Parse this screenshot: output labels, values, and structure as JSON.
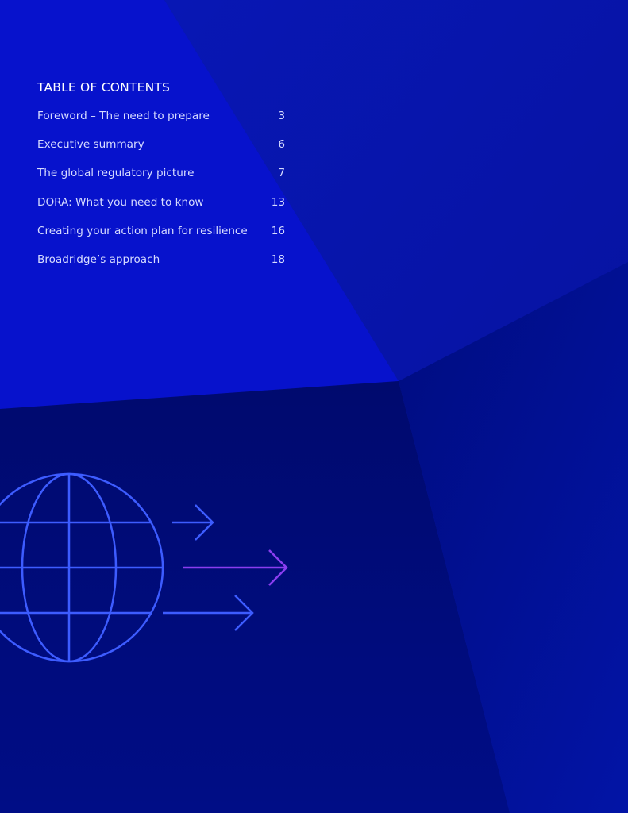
{
  "toc": {
    "title": "TABLE OF CONTENTS",
    "items": [
      {
        "label": "Foreword – The need to prepare",
        "page": "3"
      },
      {
        "label": "Executive summary",
        "page": "6"
      },
      {
        "label": "The global regulatory picture",
        "page": "7"
      },
      {
        "label": "DORA: What you need to know",
        "page": "13"
      },
      {
        "label": "Creating your action plan for resilience",
        "page": "16"
      },
      {
        "label": "Broadridge’s approach",
        "page": "18"
      }
    ]
  },
  "colors": {
    "background": "#0a0fa6",
    "panel_light": "#0712cc",
    "panel_dark": "#000c7c",
    "globe_stroke": "#3d5cff",
    "arrow_accent": "#8a3df0"
  },
  "icons": [
    "globe-icon",
    "arrow-right-icon"
  ]
}
